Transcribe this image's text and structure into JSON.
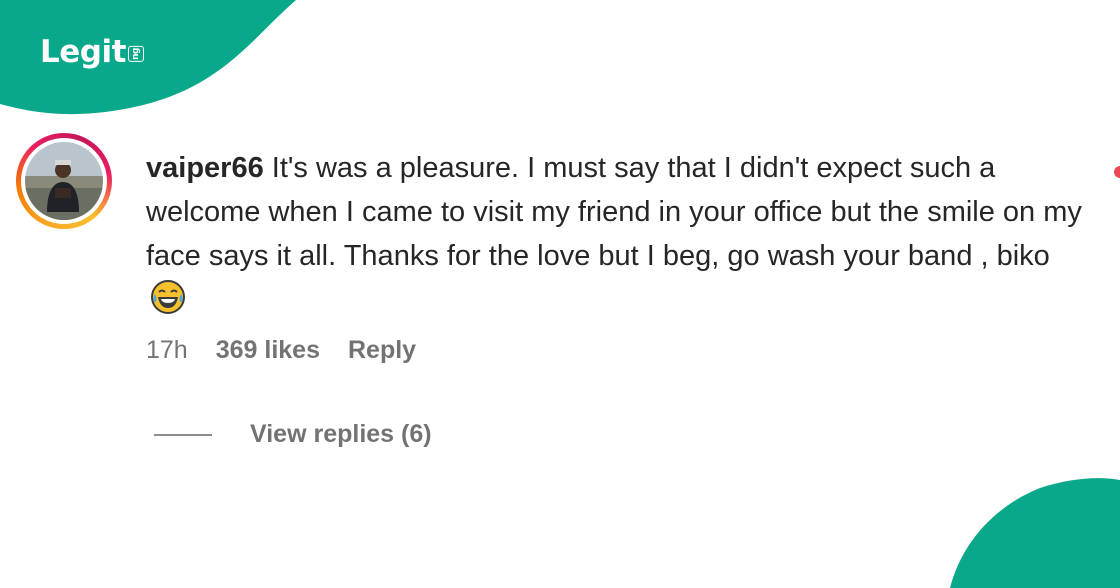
{
  "brand": {
    "logo_text": "Legit",
    "logo_suffix": "ng",
    "accent_color": "#0aa88a"
  },
  "comment": {
    "username": "vaiper66",
    "text": " It's was a pleasure. I must say that I didn't expect such a welcome when I came to visit my friend in your office but the smile on my face says it all. Thanks for the love but I beg, go wash your band , biko",
    "emoji": "face-with-tears-of-joy-icon",
    "time": "17h",
    "likes": "369 likes",
    "reply_label": "Reply",
    "view_replies": "View replies (6)"
  }
}
